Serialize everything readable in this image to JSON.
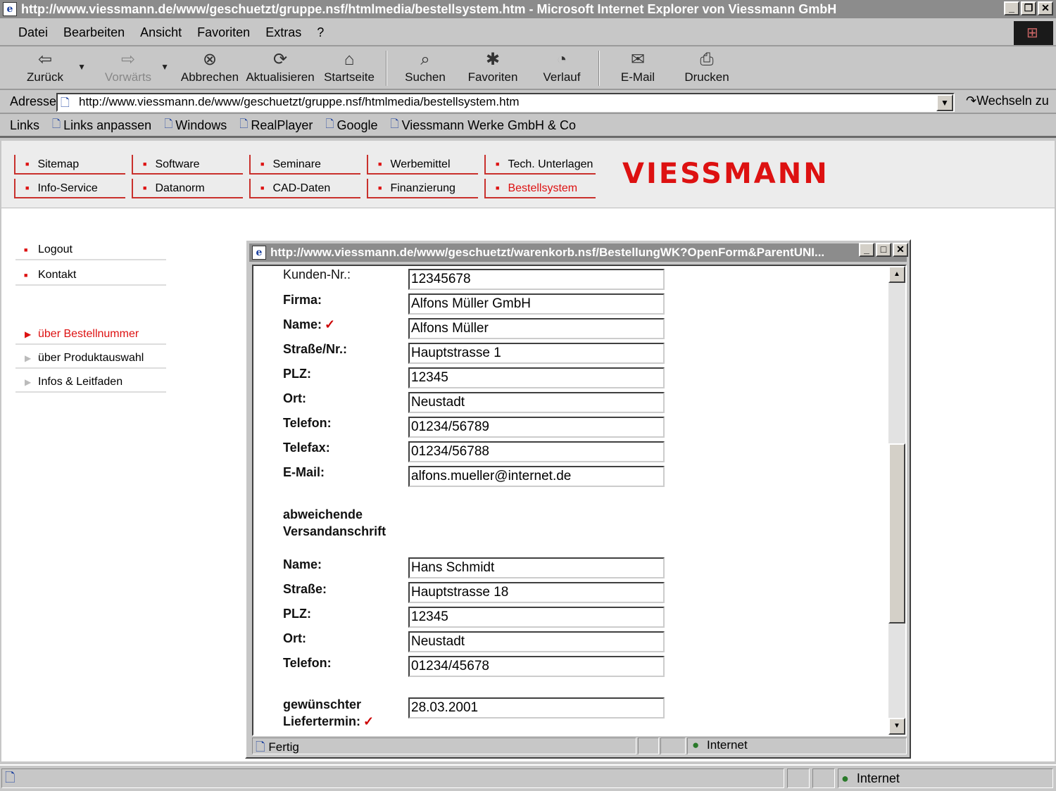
{
  "window": {
    "title": "http://www.viessmann.de/www/geschuetzt/gruppe.nsf/htmlmedia/bestellsystem.htm - Microsoft Internet Explorer von Viessmann GmbH"
  },
  "menu": [
    "Datei",
    "Bearbeiten",
    "Ansicht",
    "Favoriten",
    "Extras",
    "?"
  ],
  "toolbar": {
    "back": "Zurück",
    "forward": "Vorwärts",
    "stop": "Abbrechen",
    "refresh": "Aktualisieren",
    "home": "Startseite",
    "search": "Suchen",
    "favorites": "Favoriten",
    "history": "Verlauf",
    "mail": "E-Mail",
    "print": "Drucken"
  },
  "address": {
    "label": "Adresse",
    "url": "http://www.viessmann.de/www/geschuetzt/gruppe.nsf/htmlmedia/bestellsystem.htm",
    "go": "Wechseln zu"
  },
  "links": {
    "label": "Links",
    "items": [
      "Links anpassen",
      "Windows",
      "RealPlayer",
      "Google",
      "Viessmann Werke GmbH & Co"
    ]
  },
  "site": {
    "brand": "VIESSMANN",
    "nav_row1": [
      "Sitemap",
      "Software",
      "Seminare",
      "Werbemittel",
      "Tech. Unterlagen"
    ],
    "nav_row2": [
      "Info-Service",
      "Datanorm",
      "CAD-Daten",
      "Finanzierung",
      "Bestellsystem"
    ],
    "side_top": [
      "Logout",
      "Kontakt"
    ],
    "side_bottom": [
      "über Bestellnummer",
      "über Produktauswahl",
      "Infos & Leitfaden"
    ],
    "accent_color": "#d11111"
  },
  "popup": {
    "title": "http://www.viessmann.de/www/geschuetzt/warenkorb.nsf/BestellungWK?OpenForm&ParentUNI...",
    "fields": {
      "kundennr_label": "Kunden-Nr.:",
      "kundennr": "12345678",
      "firma_label": "Firma:",
      "firma": "Alfons Müller GmbH",
      "name_label": "Name:",
      "name": "Alfons Müller",
      "strasse_label": "Straße/Nr.:",
      "strasse": "Hauptstrasse 1",
      "plz_label": "PLZ:",
      "plz": "12345",
      "ort_label": "Ort:",
      "ort": "Neustadt",
      "telefon_label": "Telefon:",
      "telefon": "01234/56789",
      "telefax_label": "Telefax:",
      "telefax": "01234/56788",
      "email_label": "E-Mail:",
      "email": "alfons.mueller@internet.de"
    },
    "section_line1": "abweichende",
    "section_line2": "Versandanschrift",
    "shipping": {
      "name_label": "Name:",
      "name": "Hans Schmidt",
      "strasse_label": "Straße:",
      "strasse": "Hauptstrasse 18",
      "plz_label": "PLZ:",
      "plz": "12345",
      "ort_label": "Ort:",
      "ort": "Neustadt",
      "telefon_label": "Telefon:",
      "telefon": "01234/45678"
    },
    "delivery_line1": "gewünschter",
    "delivery_line2": "Liefertermin:",
    "delivery_date": "28.03.2001",
    "status": "Fertig",
    "zone": "Internet"
  },
  "statusbar": {
    "zone": "Internet"
  }
}
